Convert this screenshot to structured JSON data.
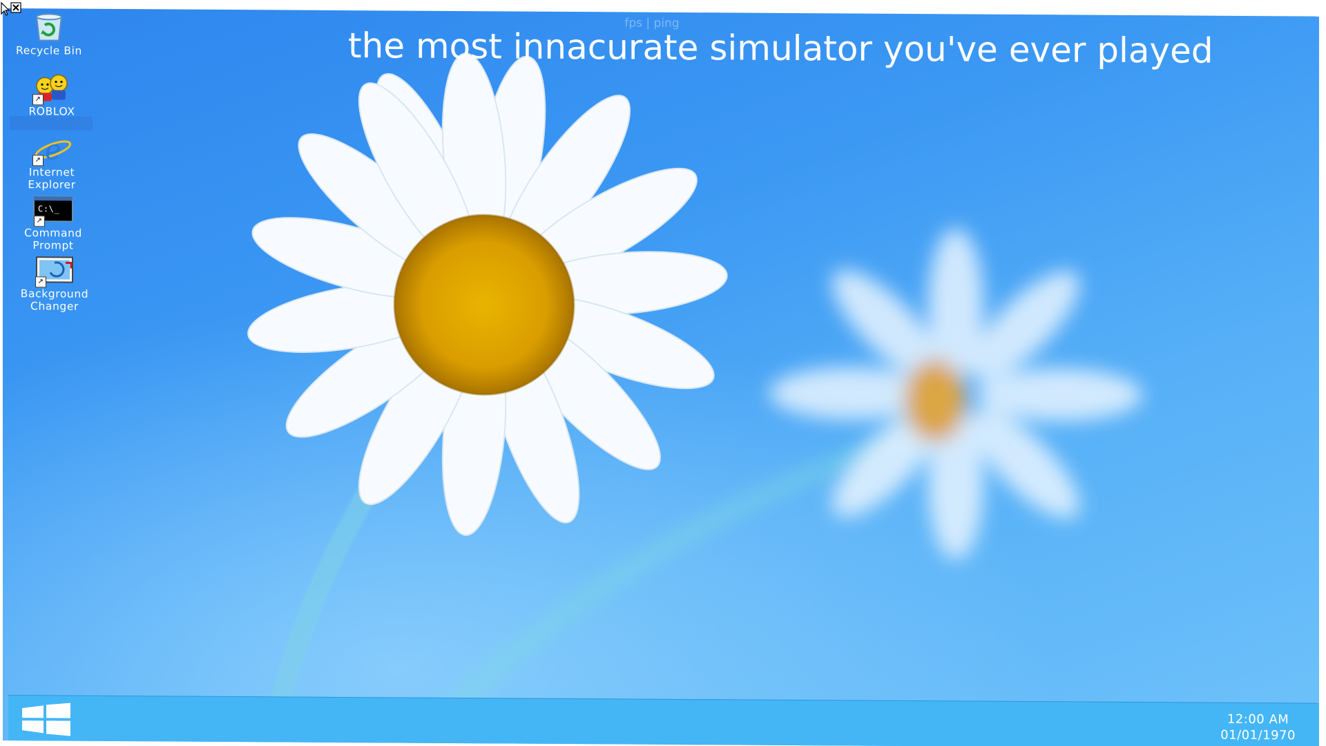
{
  "overlay": {
    "fps_ping": "fps | ping",
    "headline": "the most innacurate simulator you've ever played"
  },
  "desktop_icons": [
    {
      "label": "Recycle Bin",
      "icon": "recycle-bin-icon"
    },
    {
      "label": "ROBLOX",
      "icon": "roblox-icon"
    },
    {
      "label": "Internet Explorer",
      "icon": "internet-explorer-icon"
    },
    {
      "label": "Command Prompt",
      "icon": "command-prompt-icon"
    },
    {
      "label": "Background Changer",
      "icon": "background-changer-icon"
    }
  ],
  "taskbar": {
    "start_icon": "windows-logo-icon",
    "clock_time": "12:00 AM",
    "clock_date": "01/01/1970"
  },
  "colors": {
    "sky_top": "#2e86ee",
    "sky_bottom": "#6fc3fa",
    "taskbar": "#44b6f6",
    "text": "#ffffff"
  }
}
